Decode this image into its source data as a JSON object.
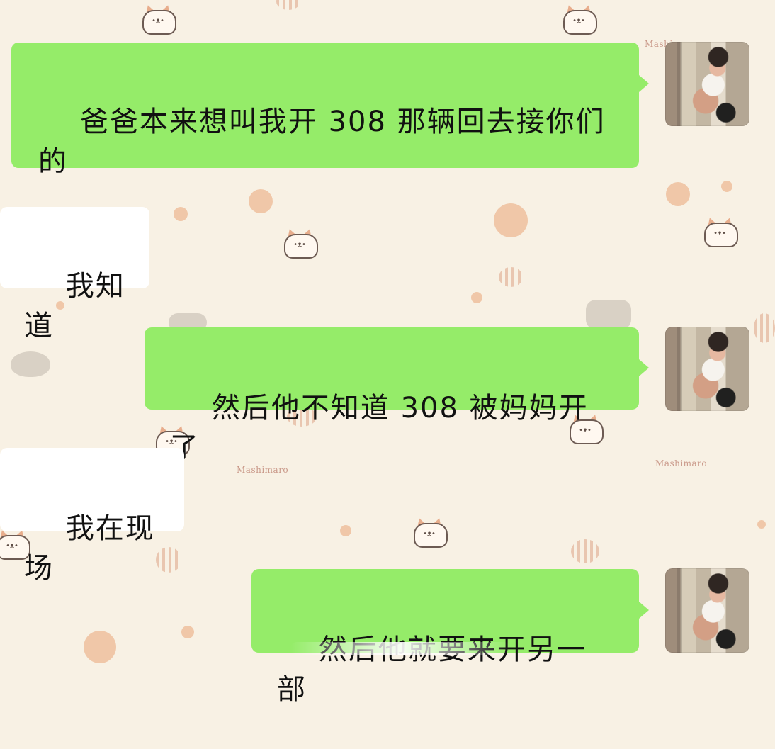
{
  "chat": {
    "messages": [
      {
        "side": "right",
        "text": "爸爸本来想叫我开 308 那辆回去接你们的",
        "style": "green"
      },
      {
        "side": "left",
        "text": "我知道",
        "style": "white"
      },
      {
        "side": "right",
        "text": "然后他不知道 308 被妈妈开了",
        "style": "green"
      },
      {
        "side": "left",
        "text": "我在现场",
        "style": "white"
      },
      {
        "side": "right",
        "text": "然后他就要来开另一部",
        "style": "green"
      }
    ]
  },
  "wallpaper": {
    "scribbles": [
      "Mashimaro",
      "Mashimaro",
      "Mashimaro"
    ],
    "pattern": "cat-and-dot"
  },
  "colors": {
    "green_bubble": "#95ec69",
    "white_bubble": "#ffffff",
    "background": "#f8f1e4"
  }
}
